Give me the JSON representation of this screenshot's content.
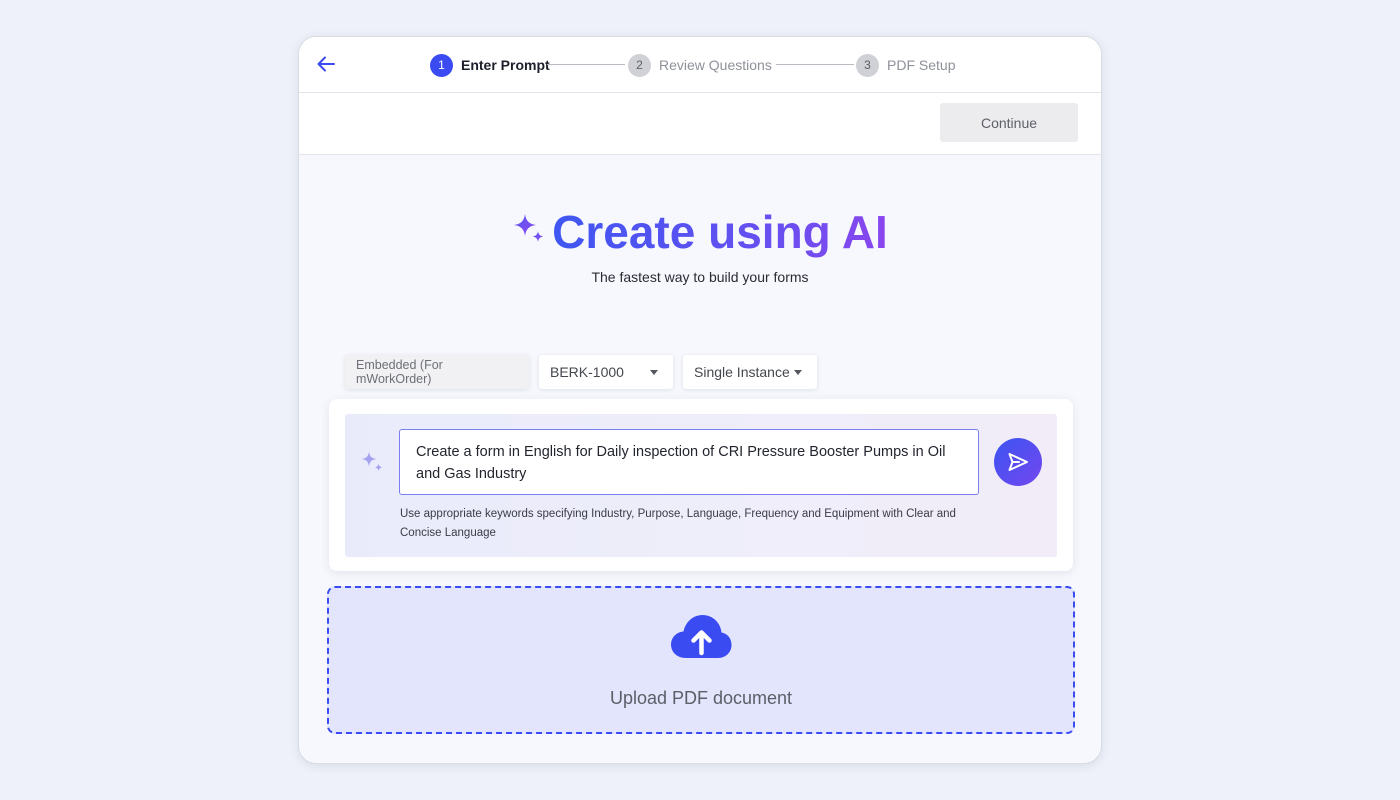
{
  "steps": [
    {
      "number": "1",
      "label": "Enter Prompt",
      "state": "active"
    },
    {
      "number": "2",
      "label": "Review Questions",
      "state": "inactive"
    },
    {
      "number": "3",
      "label": "PDF Setup",
      "state": "inactive"
    }
  ],
  "toolbar": {
    "continue_label": "Continue"
  },
  "hero": {
    "title": "Create using AI",
    "subtitle": "The fastest way to build your forms"
  },
  "filters": {
    "mode_label": "Embedded (For mWorkOrder)",
    "asset_value": "BERK-1000",
    "instance_value": "Single Instance"
  },
  "prompt": {
    "value": "Create a form in English for Daily inspection of CRI Pressure Booster Pumps in Oil and Gas Industry",
    "hint": "Use appropriate keywords specifying Industry, Purpose, Language, Frequency and Equipment with Clear and Concise Language"
  },
  "upload": {
    "label": "Upload PDF document"
  },
  "icons": {
    "back": "arrow-left-icon",
    "sparkle": "sparkle-icon",
    "send": "send-icon",
    "upload": "cloud-upload-icon",
    "dropdown": "caret-down-icon"
  },
  "colors": {
    "accent": "#3a4bf2",
    "accent_purple": "#7347ef",
    "upload_bg": "#e2e5fb"
  }
}
